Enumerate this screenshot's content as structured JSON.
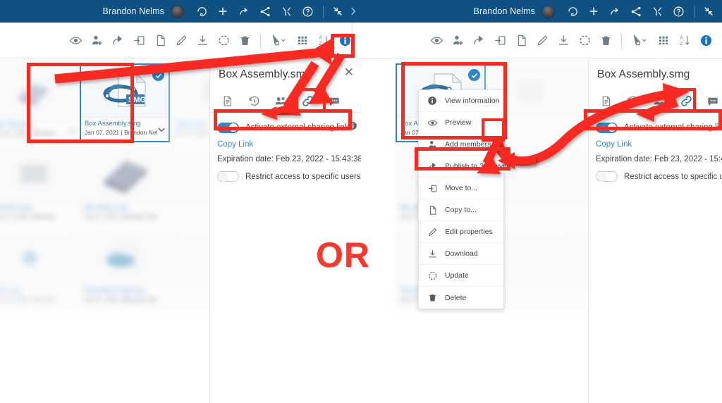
{
  "header": {
    "user_name": "Brandon Nelms",
    "icons": [
      "avatar",
      "compass-icon",
      "plus-icon",
      "share-arrow-icon",
      "network-share-icon",
      "collaboration-icon",
      "help-icon",
      "collapse-icon",
      "chevron-right-icon"
    ]
  },
  "toolbar": {
    "icons": [
      "eye-icon",
      "add-member-icon",
      "share-arrow-icon",
      "move-to-icon",
      "copy-icon",
      "edit-pencil-icon",
      "download-icon",
      "update-refresh-icon",
      "delete-trash-icon",
      "selection-cursor-icon",
      "grid-view-icon",
      "sort-az-icon",
      "info-icon"
    ],
    "info_label": "i"
  },
  "file_card": {
    "title": "Box Assembly.smg",
    "subtitle": "Jan 07, 2021 | Brandon Nel",
    "badge": "SMG",
    "selected": true,
    "checkmark": "✓",
    "chevron": "chevron-down-icon"
  },
  "panel": {
    "title": "Box Assembly.smg",
    "close_label": "✕",
    "tabs": [
      {
        "name": "properties-tab",
        "icon": "document-properties-icon",
        "active": false
      },
      {
        "name": "history-tab",
        "icon": "history-clock-icon",
        "active": false
      },
      {
        "name": "members-tab",
        "icon": "members-people-icon",
        "active": false
      },
      {
        "name": "link-tab",
        "icon": "link-chain-icon",
        "active": true
      },
      {
        "name": "comments-tab",
        "icon": "comment-bubble-icon",
        "active": false
      }
    ],
    "activate_link_label": "Activate external sharing link",
    "activate_link_on": true,
    "copy_link_label": "Copy Link",
    "expiration_label": "Expiration date: Feb 23, 2022 - 15:43:38",
    "restrict_label": "Restrict access to specific users",
    "restrict_on": false
  },
  "context_menu": {
    "items": [
      {
        "label": "View information",
        "icon": "info-circle-icon",
        "highlighted": true
      },
      {
        "label": "Preview",
        "icon": "eye-icon",
        "highlighted": false
      },
      {
        "label": "Add members",
        "icon": "add-member-icon",
        "highlighted": false
      },
      {
        "label": "Publish to 3DSwym",
        "icon": "share-arrow-icon",
        "highlighted": false
      },
      {
        "label": "Move to...",
        "icon": "move-to-icon",
        "highlighted": false
      },
      {
        "label": "Copy to...",
        "icon": "copy-icon",
        "highlighted": false
      },
      {
        "label": "Edit properties",
        "icon": "edit-pencil-icon",
        "highlighted": false
      },
      {
        "label": "Download",
        "icon": "download-icon",
        "highlighted": false
      },
      {
        "label": "Update",
        "icon": "update-refresh-icon",
        "highlighted": false
      },
      {
        "label": "Delete",
        "icon": "delete-trash-icon",
        "highlighted": false
      }
    ]
  },
  "annotation": {
    "or_text": "OR",
    "accent_color": "#f92b21",
    "or_color": "#f9372c"
  },
  "colors": {
    "header_blue": "#0f5182",
    "accent_blue": "#1975c4",
    "toggle_blue": "#2e86c8",
    "link_blue": "#2e86c8",
    "annotation_red": "#f92b21"
  }
}
